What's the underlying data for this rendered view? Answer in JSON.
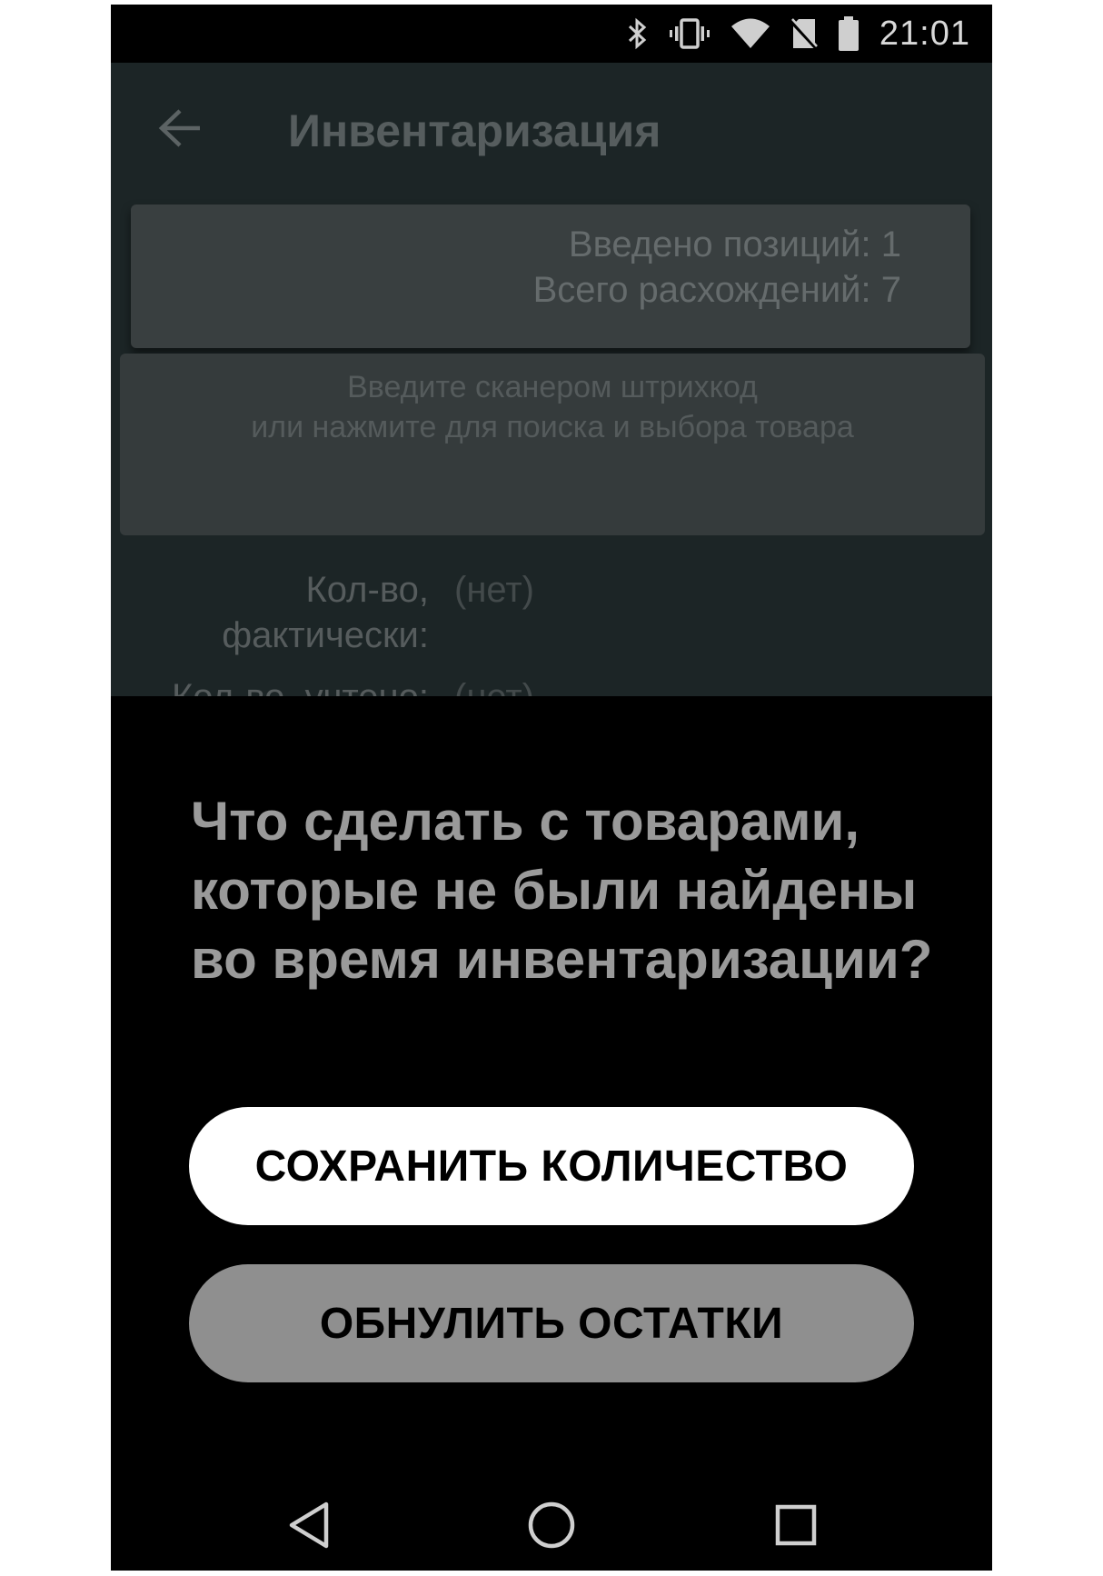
{
  "status_bar": {
    "time": "21:01",
    "icons": [
      "bluetooth-icon",
      "vibrate-icon",
      "wifi-icon",
      "no-sim-icon",
      "battery-icon"
    ]
  },
  "toolbar": {
    "title": "Инвентаризация",
    "back_icon": "arrow-left-icon"
  },
  "stats": {
    "entered_positions": "Введено позиций: 1",
    "total_discrepancies": "Всего расхождений: 7"
  },
  "search": {
    "line1": "Введите сканером штрихкод",
    "line2": "или нажмите для поиска и выбора товара"
  },
  "quantities": {
    "actual_label_1": "Кол-во,",
    "actual_label_2": "фактически:",
    "actual_value": "(нет)",
    "accounted_label": "Кол-во, учтено:",
    "accounted_value": "(нет)"
  },
  "dialog": {
    "title": "Что сделать с товарами, которые не были найдены во время инвентаризации?",
    "save_label": "СОХРАНИТЬ КОЛИЧЕСТВО",
    "reset_label": "ОБНУЛИТЬ ОСТАТКИ"
  },
  "navbar": {
    "icons": [
      "nav-back-icon",
      "nav-home-icon",
      "nav-recents-icon"
    ]
  },
  "colors": {
    "app_background": "#1c2526",
    "dialog_background": "#000000",
    "primary_button": "#ffffff",
    "secondary_button": "#8f8f8f"
  }
}
